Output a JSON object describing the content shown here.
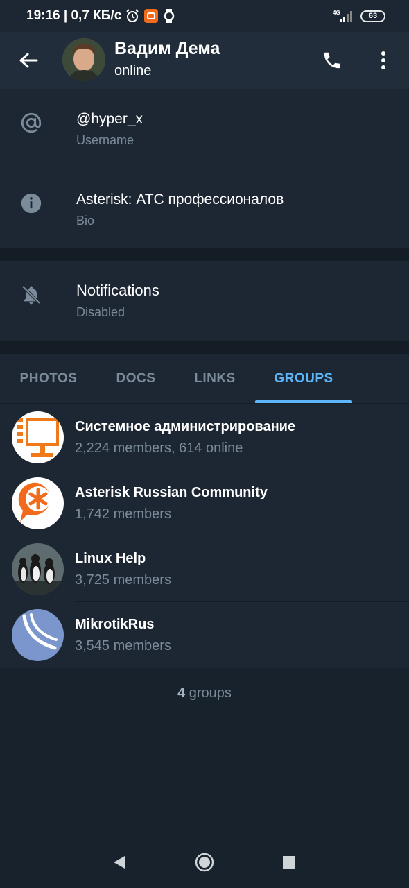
{
  "status_bar": {
    "time_speed": "19:16 | 0,7 КБ/с",
    "network": "4G",
    "battery": "63"
  },
  "header": {
    "name": "Вадим Дема",
    "status": "online"
  },
  "info": {
    "username": {
      "value": "@hyper_x",
      "label": "Username"
    },
    "bio": {
      "value": "Asterisk: АТС профессионалов",
      "label": "Bio"
    },
    "notifications": {
      "value": "Notifications",
      "label": "Disabled"
    }
  },
  "tabs": [
    {
      "label": "PHOTOS",
      "active": false
    },
    {
      "label": "DOCS",
      "active": false
    },
    {
      "label": "LINKS",
      "active": false
    },
    {
      "label": "GROUPS",
      "active": true
    }
  ],
  "groups": [
    {
      "name": "Системное администрирование",
      "meta": "2,224 members, 614 online",
      "avatar": "monitor-avatar"
    },
    {
      "name": "Asterisk Russian Community",
      "meta": "1,742 members",
      "avatar": "asterisk-avatar"
    },
    {
      "name": "Linux Help",
      "meta": "3,725 members",
      "avatar": "penguins-avatar"
    },
    {
      "name": "MikrotikRus",
      "meta": "3,545 members",
      "avatar": "mikrotik-avatar"
    }
  ],
  "group_count": {
    "number": "4",
    "suffix": " groups"
  },
  "colors": {
    "accent": "#5eb5f7",
    "background": "#18222d",
    "surface": "#1d2733",
    "header": "#212d3b",
    "secondary_text": "#7c8b99"
  }
}
